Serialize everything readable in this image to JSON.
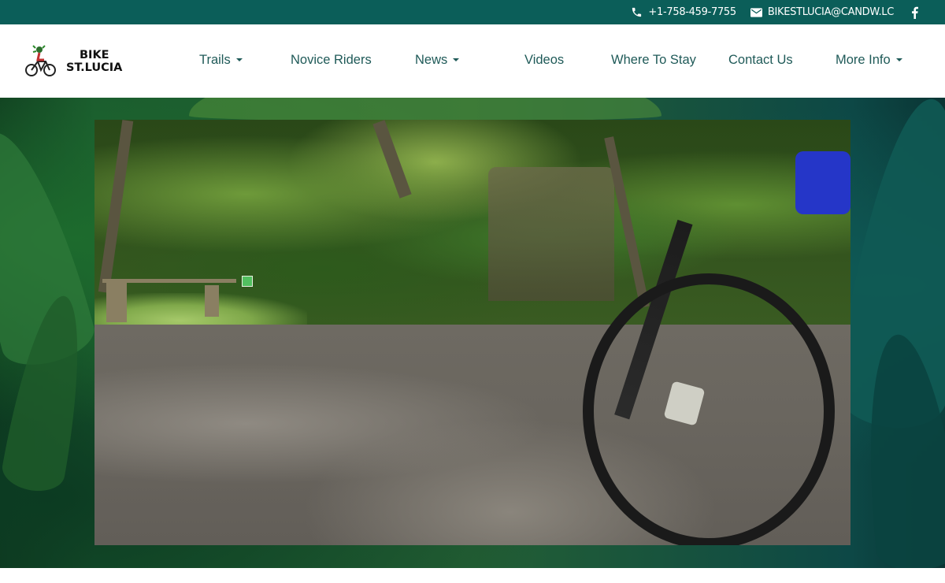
{
  "topbar": {
    "phone": "+1-758-459-7755",
    "email": "BIKESTLUCIA@CANDW.LC",
    "icons": [
      "phone-icon",
      "email-icon",
      "facebook-icon"
    ]
  },
  "brand": {
    "line1": "BIKE",
    "line2": "ST.LUCIA"
  },
  "nav": {
    "items": [
      {
        "label": "Trails",
        "dropdown": true
      },
      {
        "label": "Novice Riders",
        "dropdown": false
      },
      {
        "label": "News",
        "dropdown": true
      },
      {
        "label": "Videos",
        "dropdown": false
      },
      {
        "label": "Where To Stay",
        "dropdown": false
      },
      {
        "label": "Contact Us",
        "dropdown": false
      },
      {
        "label": "More Info",
        "dropdown": true
      }
    ]
  },
  "colors": {
    "topbar": "#0b5e59",
    "nav_text": "#1f5a58"
  }
}
